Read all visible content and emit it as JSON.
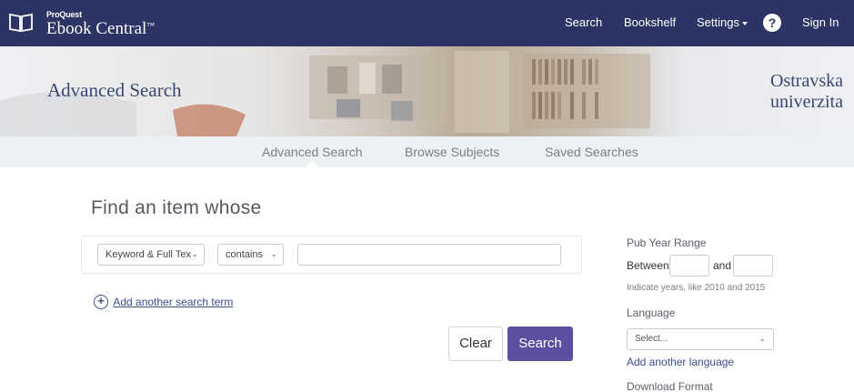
{
  "header": {
    "brand_small": "ProQuest",
    "brand_big": "Ebook Central",
    "brand_tm": "™",
    "nav": {
      "search": "Search",
      "bookshelf": "Bookshelf",
      "settings": "Settings",
      "sign_in": "Sign In"
    },
    "help_glyph": "?",
    "colors": {
      "bar": "#2b3464"
    }
  },
  "banner": {
    "title": "Advanced Search",
    "institution_line1": "Ostravska",
    "institution_line2": "univerzita"
  },
  "subnav": {
    "tabs": [
      {
        "label": "Advanced Search",
        "active": true
      },
      {
        "label": "Browse Subjects",
        "active": false
      },
      {
        "label": "Saved Searches",
        "active": false
      }
    ]
  },
  "main": {
    "heading": "Find an item whose",
    "search_row": {
      "field_select": "Keyword & Full Tex",
      "operator_select": "contains",
      "term_value": ""
    },
    "add_term_label": "Add another search term",
    "clear_label": "Clear",
    "search_label": "Search",
    "colors": {
      "search_button": "#5a4fa0",
      "link": "#3a4d8c"
    }
  },
  "filters": {
    "pub_year_range_label": "Pub Year Range",
    "between_label": "Between",
    "and_label": "and",
    "year_from": "",
    "year_to": "",
    "year_hint": "Indicate years, like 2010 and 2015",
    "language_label": "Language",
    "language_select": "Select...",
    "add_language_label": "Add another language",
    "download_format_label": "Download Format"
  },
  "icons": {
    "logo": "open-book-icon",
    "help": "question-circle-icon",
    "add": "plus-circle-icon",
    "dropdown": "chevron-down-icon"
  }
}
